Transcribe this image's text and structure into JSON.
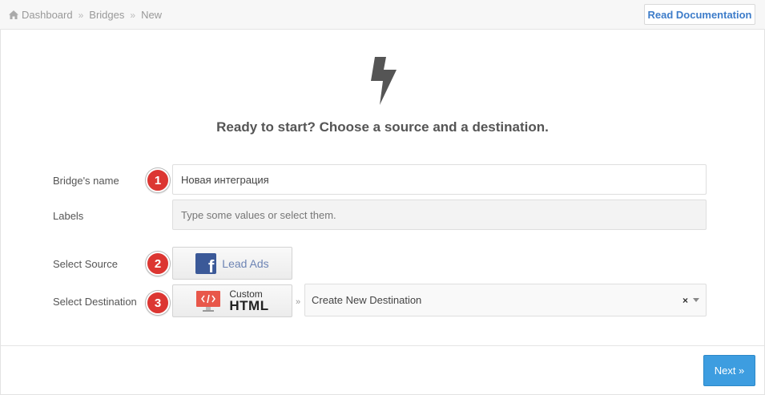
{
  "breadcrumb": {
    "items": [
      "Dashboard",
      "Bridges",
      "New"
    ],
    "separator": "»"
  },
  "header": {
    "doc_button_label": "Read Documentation"
  },
  "main": {
    "heading": "Ready to start? Choose a source and a destination.",
    "bolt_icon": "bolt-icon"
  },
  "form": {
    "name": {
      "label": "Bridge's name",
      "value": "Новая интеграция",
      "step": "1"
    },
    "labels": {
      "label": "Labels",
      "placeholder": "Type some values or select them."
    },
    "source": {
      "label": "Select Source",
      "step": "2",
      "app_name": "Lead Ads",
      "app_icon": "facebook-icon"
    },
    "destination": {
      "label": "Select Destination",
      "step": "3",
      "app_name_top": "Custom",
      "app_name_bottom": "HTML",
      "app_icon": "custom-html-icon",
      "chevron": "»",
      "selected": "Create New Destination",
      "clear_symbol": "×"
    }
  },
  "footer": {
    "next_label": "Next »"
  },
  "colors": {
    "accent": "#3d9de0",
    "link": "#3d7cc9",
    "badge": "#dc3632",
    "facebook": "#3b5998"
  }
}
